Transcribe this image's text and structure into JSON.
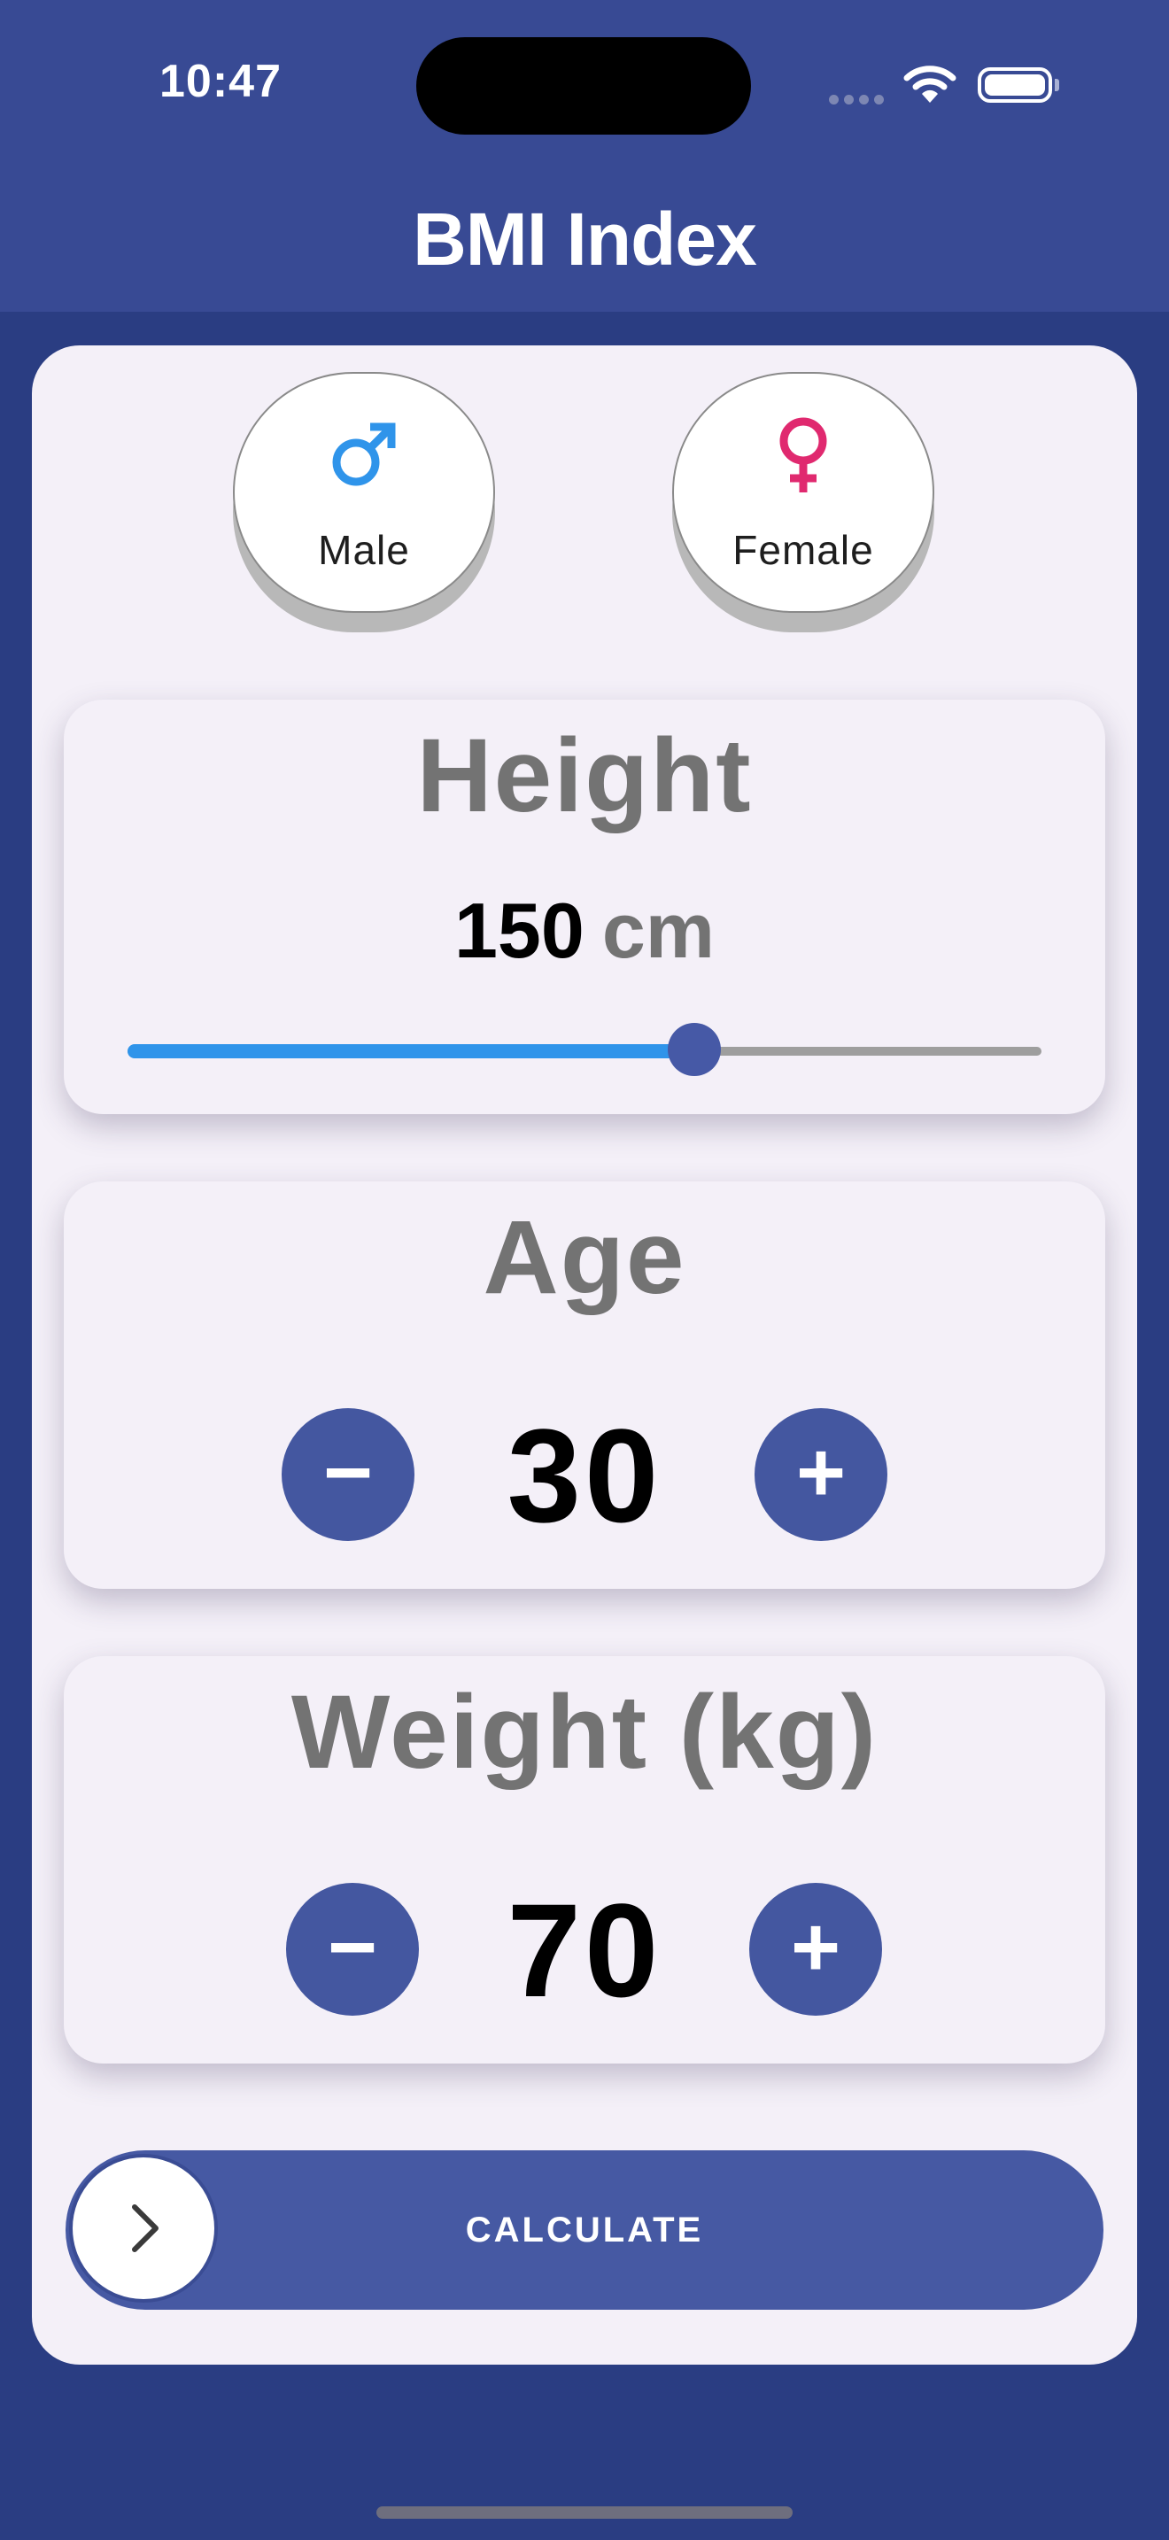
{
  "status_bar": {
    "time": "10:47"
  },
  "header": {
    "title": "BMI Index"
  },
  "gender": {
    "male": {
      "label": "Male",
      "symbol": "♂",
      "color": "#2f94ea"
    },
    "female": {
      "label": "Female",
      "symbol": "♀",
      "color": "#e0296f"
    }
  },
  "height": {
    "title": "Height",
    "value": "150",
    "unit": "cm",
    "slider_fraction": 0.62
  },
  "age": {
    "title": "Age",
    "value": "30",
    "decrement_symbol": "−",
    "increment_symbol": "+"
  },
  "weight": {
    "title": "Weight (kg)",
    "value": "70",
    "decrement_symbol": "−",
    "increment_symbol": "+"
  },
  "calculate": {
    "label": "CALCULATE",
    "icon": "chevron-right-icon"
  },
  "colors": {
    "accent": "#4457a0",
    "background": "#2a3d82",
    "card": "#f4f0f8"
  }
}
